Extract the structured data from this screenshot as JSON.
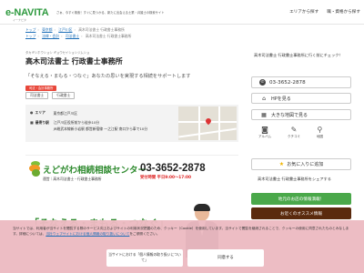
{
  "header": {
    "logo": "e-NAVITA",
    "logo_sub": "イーナビタ",
    "tagline": "さぁ、今すぐ検索！すぐに見つかる、新たに出会える士業・弁護士の検索サイト",
    "nav": [
      "エリアから探す",
      "職・資格から探す"
    ]
  },
  "breadcrumbs": {
    "line1": [
      "トップ",
      "東京都",
      "江戸川区",
      "高木司法書士 行政書士事務所"
    ],
    "line2": [
      "トップ",
      "法律・会計",
      "司法書士",
      "高木司法書士 行政書士事務所"
    ]
  },
  "office": {
    "kana": "タカギシホウショシ ギョウセイショシジムショ",
    "name": "高木司法書士 行政書士事務所",
    "catchphrase": "「そなえる・まもる・つなぐ」あなたの思いを実現する相続をサポートします",
    "badge": "司法・会計事務所",
    "tags": [
      "司法書士",
      "行政書士"
    ],
    "area_label": "エリア",
    "area_value": "東京都江戸川区",
    "access_label": "最寄り駅",
    "access_lines": [
      "江戸川区役所前から徒歩10分",
      "JR総武本線新小岩駅 都営新宿線 一之江駅 南口から車で10分"
    ]
  },
  "banner": {
    "name": "えどがわ相続相談センター",
    "sub": "運営｜高木司法書士・行政書士事務所",
    "phone": "03-3652-2878",
    "hours": "受付時間 平日9:00〜17:00",
    "slogan": "「そなえる・まもる・つなぐ」"
  },
  "sidebar": {
    "heading": "高木司法書士 行政書士事務所に行く前にチェック！",
    "phone": "03-3652-2878",
    "hp_button": "HPを見る",
    "map_button": "大きな地図で見る",
    "icons": [
      "アルバム",
      "クチコミ",
      "地図"
    ],
    "favorite": "お気に入りに追加",
    "share": "高木司法書士 行政書士事務所をシェアする",
    "green_button": "地元のお店の情報満載！",
    "dark_button": "お近くのオススメ情報"
  },
  "cookie": {
    "text_before": "当サイトでは、利用者が当サイトを閲覧する際のサービス向上およびサイトの利用状況把握のため、クッキー（Cookie）を使用しています。当サイトで閲覧を継続されることで、クッキーの使用に同意されたものとみなします。詳細については、",
    "link": "当社ウェブサイトにおける個人情報の取り扱いについて",
    "text_after": "をご参照ください。",
    "btn_policy": "当サイトにおける「個人情報の取り扱いについて」",
    "btn_agree": "同意する"
  },
  "colors": {
    "brand_green": "#2e9a3f",
    "badge_red": "#e8473a",
    "link_blue": "#1e6fb8",
    "cookie_pink": "#ecbac2",
    "dark_brown": "#5a2a0d"
  }
}
